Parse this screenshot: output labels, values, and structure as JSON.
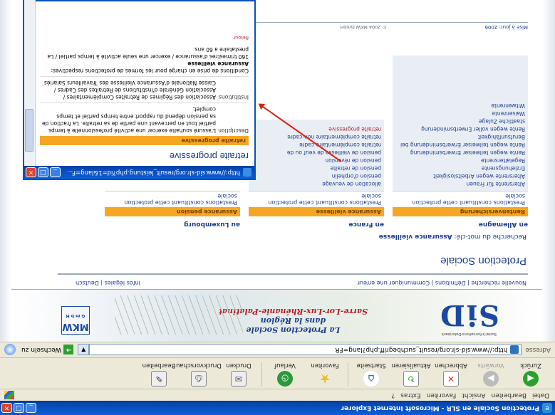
{
  "window": {
    "title": "Protection Sociale en SLR - Microsoft Internet Explorer"
  },
  "menu": [
    "Datei",
    "Bearbeiten",
    "Ansicht",
    "Favoriten",
    "Extras",
    "?"
  ],
  "toolbar": [
    {
      "label": "Zurück",
      "icon": "back-icon"
    },
    {
      "label": "Vorwärts",
      "icon": "forward-icon"
    },
    {
      "label": "Abbrechen",
      "icon": "stop-icon"
    },
    {
      "label": "Aktualisieren",
      "icon": "refresh-icon"
    },
    {
      "label": "Startseite",
      "icon": "home-icon"
    },
    {
      "label": "Favoriten",
      "icon": "favorites-icon"
    },
    {
      "label": "Verlauf",
      "icon": "history-icon"
    },
    {
      "label": "Drucken",
      "icon": "mail-icon"
    },
    {
      "label": "Druckvorschau",
      "icon": "print-icon"
    },
    {
      "label": "Bearbeiten",
      "icon": "edit-icon"
    }
  ],
  "address": {
    "label": "Adresse",
    "url": "http://www.sid-slr.org/result_suchbegriff.php?lang=FR",
    "go": "Wechseln zu"
  },
  "header": {
    "line1": "La Protection Sociale",
    "line2": "dans la Région",
    "line3": "Sarre-Lor-Lux-Rhénanie-Palatinat",
    "logo": "SiD",
    "logo_tag": "Sozial-Informations-Datenbank",
    "mkw": "MKW",
    "mkw_sub": "G m b H"
  },
  "nav": {
    "left": "Nouvelle recherche | Définitions | Communiquer une erreur",
    "right": "Infos légales | Deutsch"
  },
  "page": {
    "title": "Protection Sociale",
    "search_label": "Recherche du mot-clé:",
    "search_term": "Assurance vieillesse"
  },
  "columns": [
    {
      "head": "en Allemagne",
      "band": "Rentenversicherung",
      "sub": "Prestations constituant cette protection sociale",
      "items": [
        "Altersrente für Frauen",
        "Altersrente wegen Arbeitslosigkeit",
        "Erziehungsrente",
        "Regelaltersrente",
        "Rente wegen teilweiser Erwerbsminderung",
        "Rente wegen teilweiser Erwerbsminderung bei",
        "Berufsunfähigkeit",
        "Rente wegen voller Erwerbsminderung",
        "staatliche Zulage",
        "Waisenrente",
        "Witwenrente"
      ]
    },
    {
      "head": "en France",
      "band": "Assurance vieillesse",
      "sub": "Prestations constituant cette protection sociale",
      "items": [
        "allocation de veuvage",
        "pension d'orphelin",
        "pension de retraite",
        "pension de réversion",
        "pension de vieillesse de veuf ou de",
        "retraite complémentaire cadre",
        "retraite complémentaire non-cadre",
        "retraite progressive"
      ]
    },
    {
      "head": "au Luxembourg",
      "band": "Assurance pension",
      "sub": "Prestations constituant cette protection sociale",
      "items": []
    }
  ],
  "footer": {
    "updated": "Mise à jour: 2006",
    "copyright": "© 2004 MKW GmbH"
  },
  "popup": {
    "title": "http://www.sid-slr.org/result_leistung.php?id=1&lang=F...",
    "heading": "retraite progressive",
    "band": "retraite progressive",
    "desc_label": "Description",
    "desc": "L'assuré souhaite exercer une activité professionnelle à temps partiel tout en percevant une partie de sa retraite. La fraction de sa pension dépend du rapport entre temps partiel et temps complet.",
    "inst_label": "Institutions",
    "inst": "Association des Régimes de Retraites Complémentaires / Association Générale d'Institutions de Retraites des Cadres / Caisse Nationale d'Assurance Vieillesse des Travailleurs Salariés",
    "cond": "Conditions de prise en charge pour les formes de protections respectives:",
    "cond_head": "Assurance vieillesse",
    "cond_text": "160 trimestres d'assurance / exercer une seule activité à temps partiel / La prestataire a 60 ans.",
    "retour": "Retour"
  }
}
